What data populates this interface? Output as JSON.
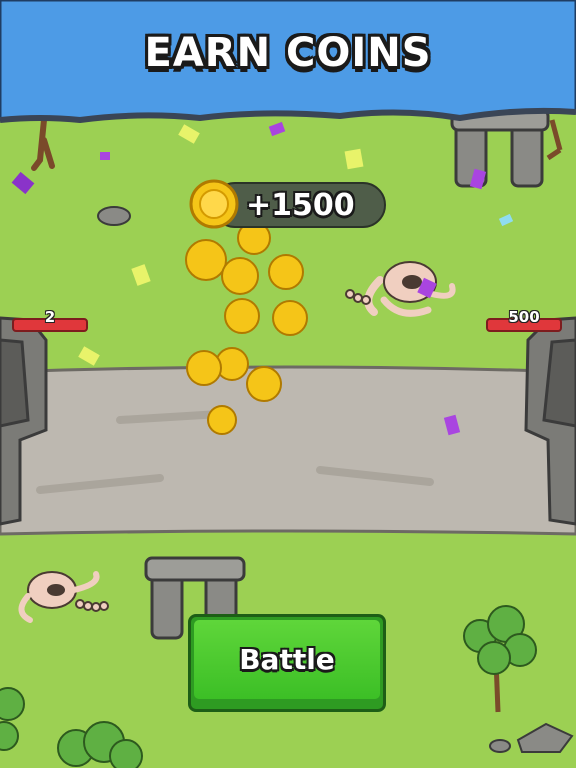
{
  "banner": {
    "title": "EARN COINS",
    "color": "#4d9be6"
  },
  "reward": {
    "amount_text": "+1500"
  },
  "health": {
    "left_value": "2",
    "right_value": "500"
  },
  "battle_button": {
    "label": "Battle",
    "color": "#4ccb2e"
  },
  "colors": {
    "grass": "#9cd053",
    "road": "#bdb8b0",
    "stone": "#8a8a86",
    "coin": "#f5c518"
  }
}
